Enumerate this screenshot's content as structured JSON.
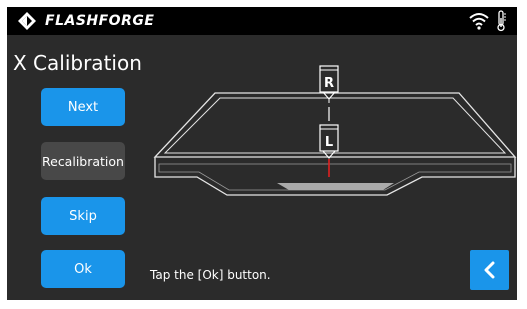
{
  "header": {
    "brand": "FLASHFORGE",
    "logo_icon": "flashforge-logo-icon",
    "wifi_icon": "wifi-icon",
    "temperature_icon": "thermometer-icon"
  },
  "page": {
    "title": "X Calibration",
    "hint": "Tap the [Ok] button."
  },
  "buttons": {
    "next": "Next",
    "recalibration": "Recalibration",
    "skip": "Skip",
    "ok": "Ok"
  },
  "diagram": {
    "nozzle_right_label": "R",
    "nozzle_left_label": "L"
  },
  "colors": {
    "accent": "#1a95ea",
    "secondary_button": "#484848",
    "background": "#2b2b2b",
    "indicator": "#e02020"
  }
}
